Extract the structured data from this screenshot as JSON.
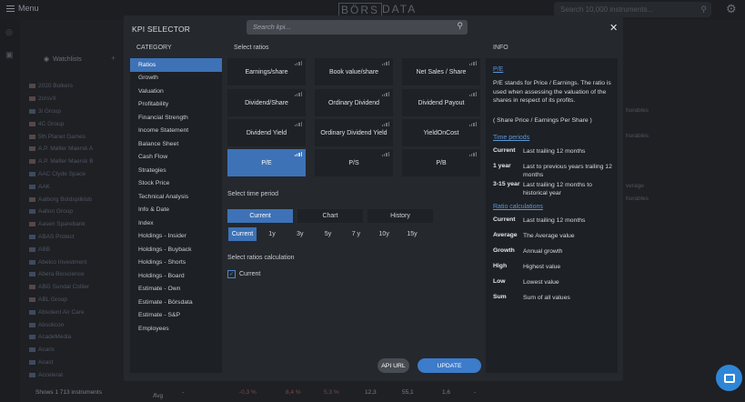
{
  "topbar": {
    "menu_label": "Menu",
    "logo_boxed": "BÖRS",
    "logo_rest": "DATA",
    "search_placeholder": "Search 10,000 instruments..."
  },
  "watchlists": {
    "label": "Watchlists"
  },
  "background_list": [
    {
      "name": "2020 Bulkers",
      "flag": "no"
    },
    {
      "name": "2crsvX",
      "flag": "no"
    },
    {
      "name": "3i Group",
      "flag": "uk"
    },
    {
      "name": "4C Group",
      "flag": "no"
    },
    {
      "name": "5th Planet Games",
      "flag": "no"
    },
    {
      "name": "A.P. Møller Maersk A",
      "flag": "no"
    },
    {
      "name": "A.P. Møller Maersk B",
      "flag": "no"
    },
    {
      "name": "AAC Clyde Space",
      "flag": "se"
    },
    {
      "name": "AAK",
      "flag": "se"
    },
    {
      "name": "Aalborg Boldspilklub",
      "flag": "no"
    },
    {
      "name": "Aallon Group",
      "flag": "fi"
    },
    {
      "name": "Aasen Sparebank",
      "flag": "no"
    },
    {
      "name": "ABAS Protect",
      "flag": "se"
    },
    {
      "name": "ABB",
      "flag": "se"
    },
    {
      "name": "Abelco Investment",
      "flag": "se"
    },
    {
      "name": "Abera Bioscience",
      "flag": "se"
    },
    {
      "name": "ABG Sundal Collier",
      "flag": "no"
    },
    {
      "name": "ABL Group",
      "flag": "no"
    },
    {
      "name": "Absolent Air Care",
      "flag": "se"
    },
    {
      "name": "Absolicon",
      "flag": "se"
    },
    {
      "name": "AcadeMedia",
      "flag": "se"
    },
    {
      "name": "Acarix",
      "flag": "se"
    },
    {
      "name": "Acast",
      "flag": "se"
    },
    {
      "name": "Accelerat",
      "flag": "se"
    }
  ],
  "background_right": [
    "hurables",
    "hurables",
    "verage",
    "hurables"
  ],
  "bottom": {
    "count": "Shows 1 713 instruments",
    "agg": "Avg",
    "v1": "-0,3 %",
    "v2": "8,4 %",
    "v3": "5,3 %",
    "v4": "12,3",
    "v5": "55,1",
    "v6": "1,6"
  },
  "modal": {
    "title": "KPI SELECTOR",
    "search_placeholder": "Search kpi...",
    "category_header": "CATEGORY",
    "ratios_header": "Select ratios",
    "info_header": "INFO",
    "categories": [
      "Ratios",
      "Growth",
      "Valuation",
      "Profitability",
      "Financial Strength",
      "Income Statement",
      "Balance Sheet",
      "Cash Flow",
      "Strategies",
      "Stock Price",
      "Technical Analysis",
      "Info & Date",
      "Index",
      "Holdings - Insider",
      "Holdings - Buyback",
      "Holdings - Shorts",
      "Holdings - Board",
      "Estimate - Own",
      "Estimate - Börsdata",
      "Estimate - S&P",
      "Employees"
    ],
    "active_category": "Ratios",
    "ratios": [
      [
        "Earnings/share",
        "Book value/share",
        "Net Sales / Share"
      ],
      [
        "Dividend/Share",
        "Ordinary Dividend",
        "Dividend Payout"
      ],
      [
        "Dividend Yield",
        "Ordinary Dividend Yield",
        "YieldOnCost"
      ],
      [
        "P/E",
        "P/S",
        "P/B"
      ]
    ],
    "active_ratio": "P/E",
    "time_period_label": "Select time period",
    "view_tabs": [
      "Current",
      "Chart",
      "History"
    ],
    "periods": [
      "Current",
      "1y",
      "3y",
      "5y",
      "7 y",
      "10y",
      "15y"
    ],
    "calc_label": "Select ratios calculation",
    "calc_option": "Current",
    "api_button": "API URL",
    "update_button": "UPDATE",
    "info": {
      "title": "P/E",
      "description": "P/E stands for Price / Earnings. The ratio is used when assessing the valuation of the shares in respect of its profits.",
      "formula": "( Share Price / Earnings Per Share )",
      "time_periods_title": "Time periods",
      "time_periods": [
        {
          "key": "Current",
          "value": "Last trailing 12 months"
        },
        {
          "key": "1 year",
          "value": "Last to previous years trailing 12 months"
        },
        {
          "key": "3-15 year",
          "value": "Last trailing 12 months to historical year"
        }
      ],
      "calc_title": "Ratio calculations",
      "calcs": [
        {
          "key": "Current",
          "value": "Last trailing 12 months"
        },
        {
          "key": "Average",
          "value": "The Average value"
        },
        {
          "key": "Growth",
          "value": "Annual growth"
        },
        {
          "key": "High",
          "value": "Highest value"
        },
        {
          "key": "Low",
          "value": "Lowest value"
        },
        {
          "key": "Sum",
          "value": "Sum of all values"
        }
      ]
    }
  }
}
